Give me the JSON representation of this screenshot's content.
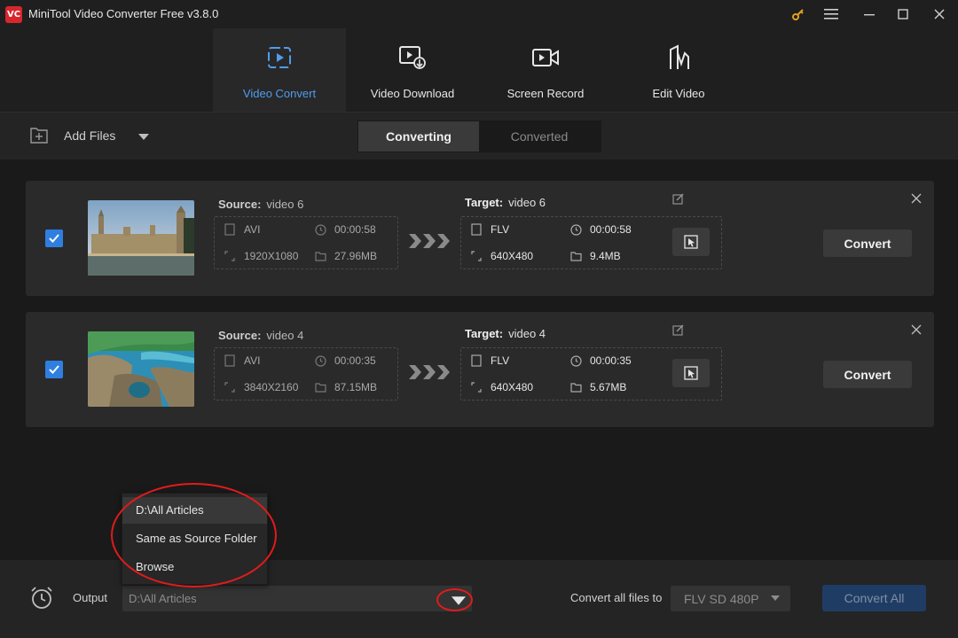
{
  "window": {
    "logo_text": "VC",
    "title": "MiniTool Video Converter Free v3.8.0",
    "controls": [
      "key-icon",
      "menu-icon",
      "minimize-icon",
      "maximize-icon",
      "close-icon"
    ]
  },
  "nav": {
    "tabs": [
      {
        "label": "Video Convert",
        "icon": "video-convert-icon",
        "active": true
      },
      {
        "label": "Video Download",
        "icon": "video-download-icon",
        "active": false
      },
      {
        "label": "Screen Record",
        "icon": "screen-record-icon",
        "active": false
      },
      {
        "label": "Edit Video",
        "icon": "edit-video-icon",
        "active": false
      }
    ]
  },
  "toolbar": {
    "add_files": "Add Files",
    "segments": [
      {
        "label": "Converting",
        "active": true
      },
      {
        "label": "Converted",
        "active": false
      }
    ]
  },
  "items": [
    {
      "checked": true,
      "source_label": "Source:",
      "source_name": "video 6",
      "source_format": "AVI",
      "source_duration": "00:00:58",
      "source_resolution": "1920X1080",
      "source_size": "27.96MB",
      "target_label": "Target:",
      "target_name": "video 6",
      "target_format": "FLV",
      "target_duration": "00:00:58",
      "target_resolution": "640X480",
      "target_size": "9.4MB",
      "convert_label": "Convert"
    },
    {
      "checked": true,
      "source_label": "Source:",
      "source_name": "video 4",
      "source_format": "AVI",
      "source_duration": "00:00:35",
      "source_resolution": "3840X2160",
      "source_size": "87.15MB",
      "target_label": "Target:",
      "target_name": "video 4",
      "target_format": "FLV",
      "target_duration": "00:00:35",
      "target_resolution": "640X480",
      "target_size": "5.67MB",
      "convert_label": "Convert"
    }
  ],
  "output": {
    "label": "Output",
    "value": "D:\\All Articles",
    "menu": [
      "D:\\All Articles",
      "Same as Source Folder",
      "Browse"
    ]
  },
  "convert_all": {
    "label": "Convert all files to",
    "format": "FLV SD 480P",
    "button": "Convert All"
  },
  "colors": {
    "accent": "#4f9cf0",
    "checkbox": "#2f7fe0",
    "convert_all_bg": "#1f3c64",
    "annotation": "#e11b1b"
  }
}
